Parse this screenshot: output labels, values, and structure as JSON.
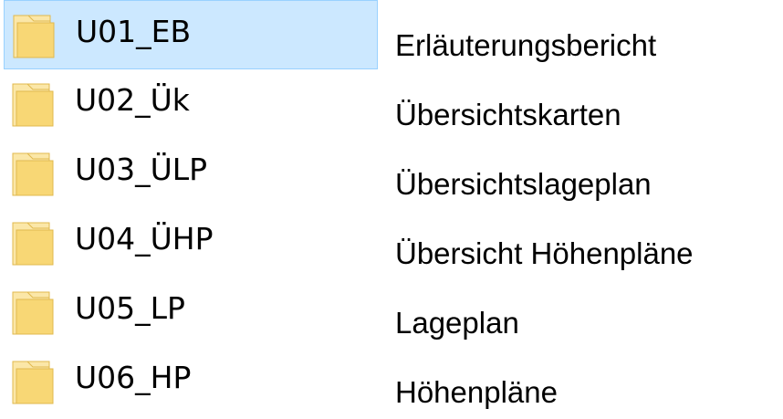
{
  "folders": [
    {
      "name": "U01_EB",
      "description": "Erläuterungsbericht",
      "selected": true
    },
    {
      "name": "U02_Ük",
      "description": "Übersichtskarten",
      "selected": false
    },
    {
      "name": "U03_ÜLP",
      "description": "Übersichtslageplan",
      "selected": false
    },
    {
      "name": "U04_ÜHP",
      "description": "Übersicht Höhenpläne",
      "selected": false
    },
    {
      "name": "U05_LP",
      "description": "Lageplan",
      "selected": false
    },
    {
      "name": "U06_HP",
      "description": "Höhenpläne",
      "selected": false
    }
  ],
  "colors": {
    "selection_background": "#cce8ff",
    "selection_border": "#99d1ff",
    "folder_body": "#f8d775",
    "folder_light": "#fbe7a8",
    "folder_edge": "#e0b94e"
  },
  "icon": "folder-icon"
}
